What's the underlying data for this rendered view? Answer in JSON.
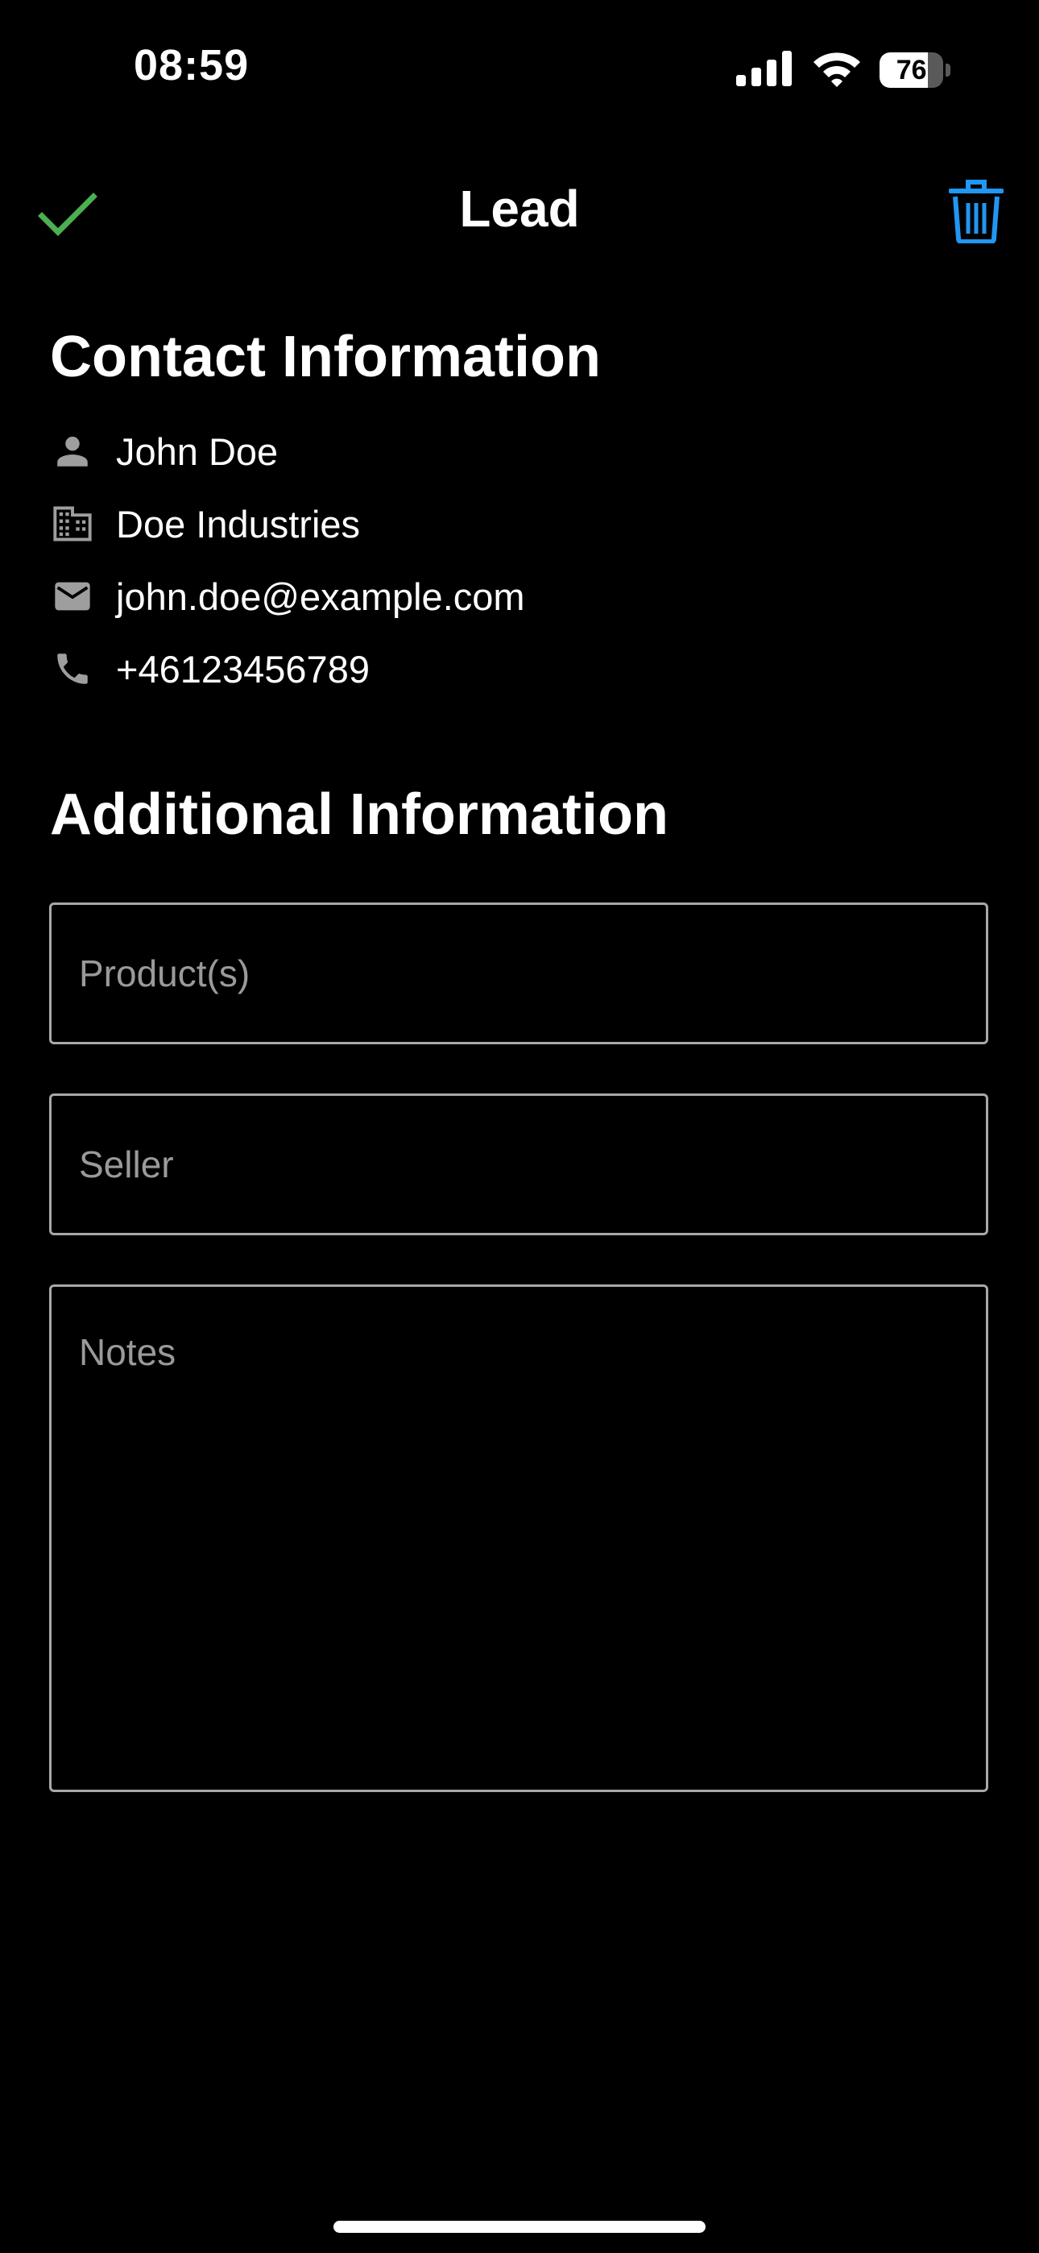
{
  "status_bar": {
    "time": "08:59",
    "battery_level": "76",
    "battery_fraction": 0.76,
    "icons": [
      "cellular-signal-icon",
      "wifi-icon",
      "battery-icon"
    ]
  },
  "nav": {
    "title": "Lead",
    "done_icon": "checkmark-icon",
    "delete_icon": "trash-icon",
    "colors": {
      "done": "#4CAF50",
      "delete": "#2196F3"
    }
  },
  "contact": {
    "section_title": "Contact Information",
    "items": [
      {
        "icon": "person-icon",
        "value": "John Doe"
      },
      {
        "icon": "building-icon",
        "value": "Doe Industries"
      },
      {
        "icon": "email-icon",
        "value": "john.doe@example.com"
      },
      {
        "icon": "phone-icon",
        "value": "+46123456789"
      }
    ]
  },
  "additional": {
    "section_title": "Additional Information",
    "fields": {
      "products": {
        "value": "",
        "placeholder": "Product(s)"
      },
      "seller": {
        "value": "",
        "placeholder": "Seller"
      },
      "notes": {
        "value": "",
        "placeholder": "Notes"
      }
    }
  },
  "colors": {
    "background": "#000000",
    "text": "#FFFFFF",
    "icon_gray": "#9E9E9E",
    "field_border": "#A8A8A8",
    "placeholder": "#9A9A9A"
  }
}
